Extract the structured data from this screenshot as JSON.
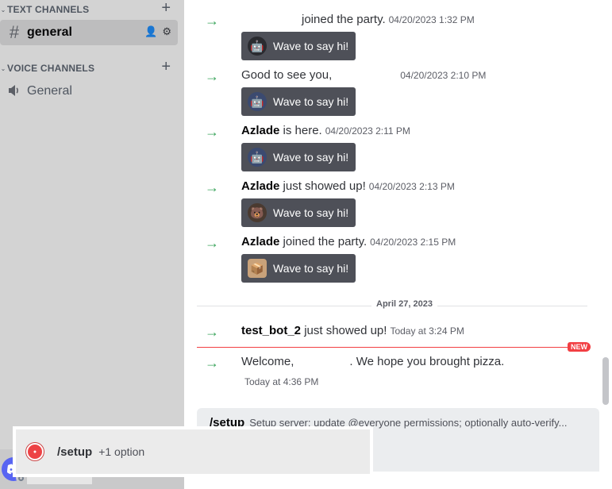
{
  "sidebar": {
    "text_category": "TEXT CHANNELS",
    "voice_category": "VOICE CHANNELS",
    "text_channels": [
      {
        "name": "general"
      }
    ],
    "voice_channels": [
      {
        "name": "General"
      }
    ]
  },
  "messages": [
    {
      "user": "",
      "action": "joined the party.",
      "timestamp": "04/20/2023 1:32 PM",
      "wave": "Wave to say hi!"
    },
    {
      "user": "",
      "action": "Good to see you,",
      "timestamp": "04/20/2023 2:10 PM",
      "wave": "Wave to say hi!"
    },
    {
      "user": "Azlade",
      "action": "is here.",
      "timestamp": "04/20/2023 2:11 PM",
      "wave": "Wave to say hi!"
    },
    {
      "user": "Azlade",
      "action": "just showed up!",
      "timestamp": "04/20/2023 2:13 PM",
      "wave": "Wave to say hi!"
    },
    {
      "user": "Azlade",
      "action": "joined the party.",
      "timestamp": "04/20/2023 2:15 PM",
      "wave": "Wave to say hi!"
    }
  ],
  "date_divider": "April 27, 2023",
  "new_messages": [
    {
      "user": "test_bot_2",
      "action": "just showed up!",
      "timestamp": "Today at 3:24 PM"
    },
    {
      "prefix": "Welcome,",
      "suffix": ". We hope you brought pizza.",
      "timestamp": "Today at 4:36 PM"
    }
  ],
  "new_tag": "NEW",
  "command_popup": {
    "name": "/setup",
    "description": "Setup server: update @everyone permissions; optionally auto-verify...",
    "item_name": "/setup",
    "item_options": "+1 option"
  },
  "colors": {
    "accent": "#5865f2",
    "join_arrow": "#3ba55c",
    "new_line": "#f23f43"
  }
}
